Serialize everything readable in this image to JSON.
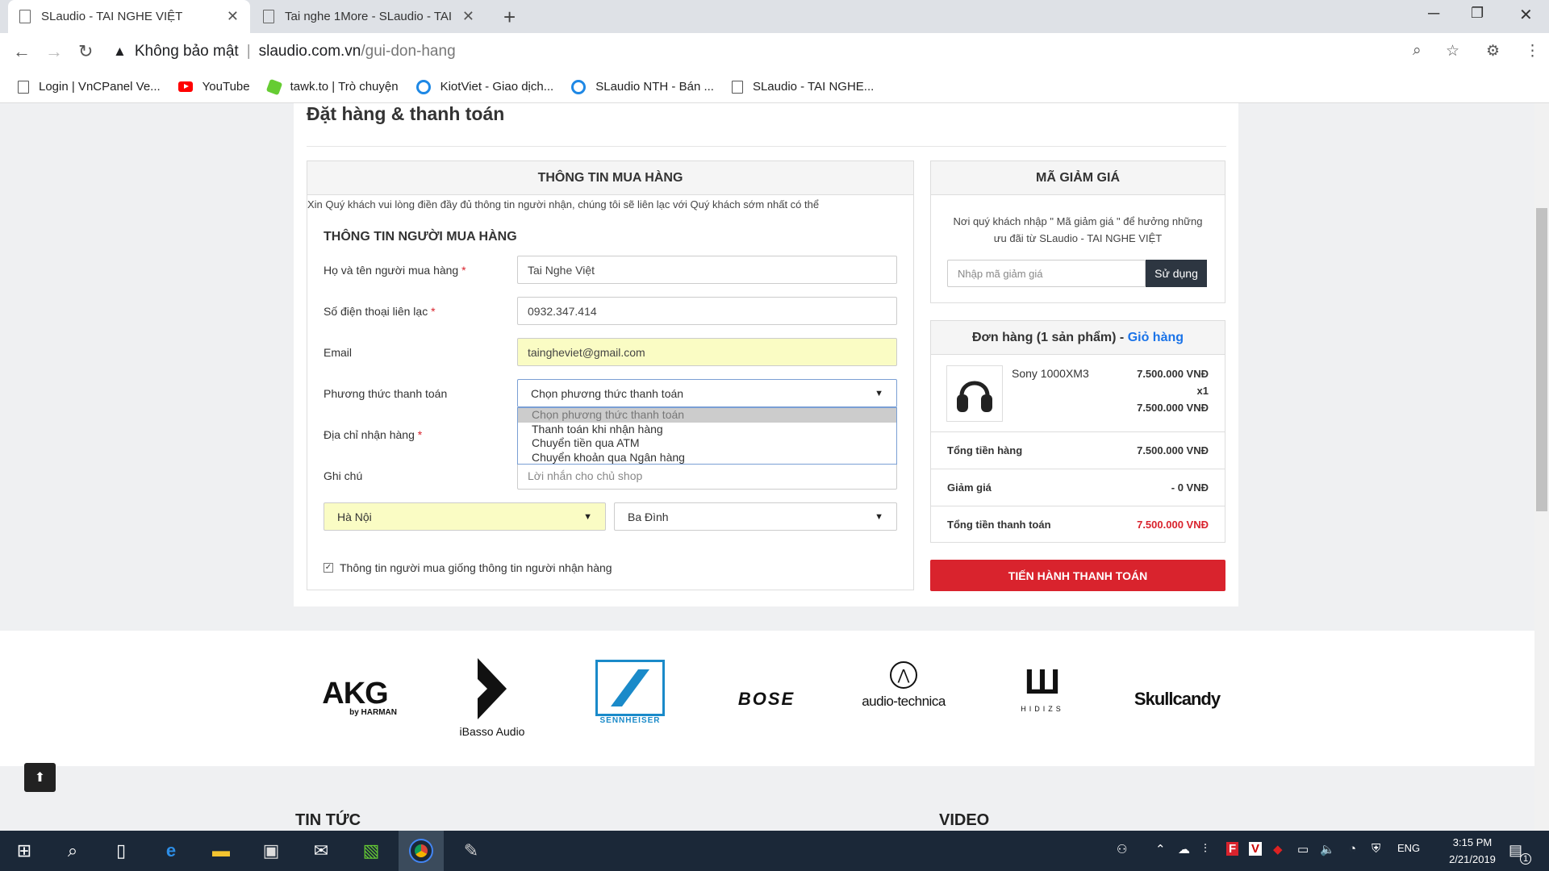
{
  "browser": {
    "tabs": [
      {
        "title": "SLaudio - TAI NGHE VIỆT",
        "active": true
      },
      {
        "title": "Tai nghe 1More - SLaudio - TAI NGHE VIỆT",
        "active": false
      }
    ],
    "new_tab": "+",
    "security_label": "Không bảo mật",
    "url_domain": "slaudio.com.vn",
    "url_path": "/gui-don-hang",
    "bookmarks": [
      "Login | VnCPanel Ve...",
      "YouTube",
      "tawk.to | Trò chuyện",
      "KiotViet - Giao dịch...",
      "SLaudio NTH - Bán ...",
      "SLaudio - TAI NGHE..."
    ]
  },
  "page": {
    "title": "Đặt hàng & thanh toán",
    "buyer_panel": {
      "heading": "THÔNG TIN MUA HÀNG",
      "intro": "Xin Quý khách vui lòng điền đầy đủ thông tin người nhận, chúng tôi sẽ liên lạc với Quý khách sớm nhất có thể",
      "subheading": "THÔNG TIN NGƯỜI MUA HÀNG",
      "fields": {
        "name_label": "Họ và tên người mua hàng",
        "name_value": "Tai Nghe Việt",
        "phone_label": "Số điện thoại liên lạc",
        "phone_value": "0932.347.414",
        "email_label": "Email",
        "email_value": "taingheviet@gmail.com",
        "payment_label": "Phương thức thanh toán",
        "payment_value": "Chọn phương thức thanh toán",
        "address_label": "Địa chỉ nhận hàng",
        "note_label": "Ghi chú",
        "note_placeholder": "Lời nhắn cho chủ shop",
        "city_value": "Hà Nội",
        "district_value": "Ba Đình",
        "same_info_label": "Thông tin người mua giống thông tin người nhận hàng",
        "required_mark": "*"
      },
      "payment_options": [
        "Chọn phương thức thanh toán",
        "Thanh toán khi nhận hàng",
        "Chuyển tiền qua ATM",
        "Chuyển khoản qua Ngân hàng"
      ]
    },
    "coupon_panel": {
      "heading": "MÃ GIẢM GIÁ",
      "desc": "Nơi quý khách nhập \" Mã giảm giá \" để hưởng những ưu đãi từ SLaudio - TAI NGHE VIỆT",
      "placeholder": "Nhập mã giảm giá",
      "button": "Sử dụng"
    },
    "order_panel": {
      "heading": "Đơn hàng (1 sản phẩm) - ",
      "cart_link": "Giỏ hàng",
      "item_name": "Sony 1000XM3",
      "item_price": "7.500.000 VNĐ",
      "item_qty": "x1",
      "item_total": "7.500.000 VNĐ",
      "subtotal_label": "Tổng tiền hàng",
      "subtotal_value": "7.500.000 VNĐ",
      "discount_label": "Giảm giá",
      "discount_value": "- 0 VNĐ",
      "total_label": "Tổng tiền thanh toán",
      "total_value": "7.500.000 VNĐ"
    },
    "checkout_button": "TIẾN HÀNH THANH TOÁN",
    "brands": [
      "AKG",
      "by HARMAN",
      "iBasso Audio",
      "SENNHEISER",
      "BOSE",
      "audio-technica",
      "HIDIZS",
      "Skullcandy"
    ],
    "sections": [
      "TIN TỨC",
      "VIDEO"
    ]
  },
  "taskbar": {
    "lang": "ENG",
    "time": "3:15 PM",
    "date": "2/21/2019",
    "notif": "1"
  },
  "colors": {
    "accent_red": "#d9232d",
    "link_blue": "#1a73e8",
    "taskbar": "#1b2838"
  }
}
